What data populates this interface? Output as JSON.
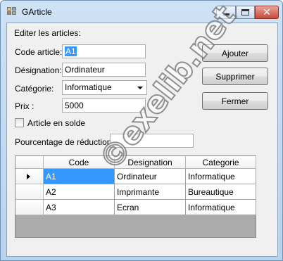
{
  "window": {
    "title": "GArticle"
  },
  "form": {
    "header": "Editer les articles:",
    "code": {
      "label": "Code article:",
      "value": "A1"
    },
    "designation": {
      "label": "Désignation:",
      "value": "Ordinateur"
    },
    "categorie": {
      "label": "Catégorie:",
      "value": "Informatique"
    },
    "prix": {
      "label": "Prix :",
      "value": "5000"
    },
    "solde": {
      "label": "Article en solde",
      "checked": false
    },
    "reduction": {
      "label": "Pourcentage de réduction :",
      "value": ""
    }
  },
  "buttons": {
    "ajouter": "Ajouter",
    "supprimer": "Supprimer",
    "fermer": "Fermer"
  },
  "grid": {
    "columns": [
      "Code",
      "Designation",
      "Categorie"
    ],
    "rows": [
      [
        "A1",
        "Ordinateur",
        "Informatique"
      ],
      [
        "A2",
        "Imprimante",
        "Bureautique"
      ],
      [
        "A3",
        "Ecran",
        "Informatique"
      ]
    ]
  },
  "watermark": "©exelib.net"
}
